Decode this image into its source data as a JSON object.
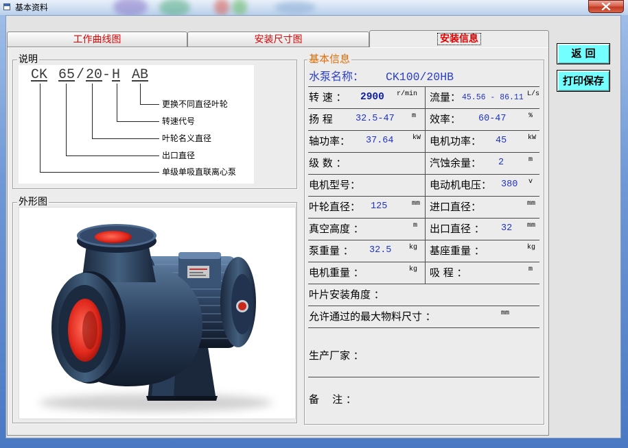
{
  "window": {
    "title": "基本资料"
  },
  "icons": {
    "window": "window-icon",
    "close": "close-icon"
  },
  "tabs": [
    {
      "label": "工作曲线图",
      "selected": false
    },
    {
      "label": "安装尺寸图",
      "selected": false
    },
    {
      "label": "安装信息",
      "selected": true
    }
  ],
  "buttons": {
    "back": "返 回",
    "print_save": "打印保存"
  },
  "description": {
    "title": "说明",
    "model_code_parts": [
      "CK",
      "65",
      "/",
      "20",
      "-",
      "H",
      "AB"
    ],
    "legend": [
      "更换不同直径叶轮",
      "转速代号",
      "叶轮名义直径",
      "出口直径",
      "单级单吸直联离心泵"
    ]
  },
  "appearance": {
    "title": "外形图"
  },
  "basic_info": {
    "title": "基本信息",
    "pump_name_label": "水泵名称：",
    "pump_name": "CK100/20HB",
    "rows": [
      {
        "left": {
          "label": "转 速 ：",
          "value": "2900",
          "unit": "r/min"
        },
        "right": {
          "label": "流量：",
          "value": "45.56 - 86.11",
          "unit": "L/s"
        }
      },
      {
        "left": {
          "label": "扬 程",
          "value": "32.5-47",
          "unit": "m"
        },
        "right": {
          "label": "效率：",
          "value": "60-47",
          "unit": "%"
        }
      },
      {
        "left": {
          "label": "轴功率：",
          "value": "37.64",
          "unit": "kW"
        },
        "right": {
          "label": "电机功率：",
          "value": "45",
          "unit": "kW"
        }
      },
      {
        "left": {
          "label": "级 数 ："
        },
        "right": {
          "label": "汽蚀余量：",
          "value": "2",
          "unit": "m"
        }
      },
      {
        "left": {
          "label": "电机型号："
        },
        "right": {
          "label": "电动机电压：",
          "value": "380",
          "unit": "v"
        }
      },
      {
        "left": {
          "label": "叶轮直径：",
          "value": "125",
          "unit": "mm"
        },
        "right": {
          "label": "进口直径：",
          "unit": "mm"
        }
      },
      {
        "left": {
          "label": "真空高度 ：",
          "unit": "m"
        },
        "right": {
          "label": "出口直径 ：",
          "value": "32",
          "unit": "mm"
        }
      },
      {
        "left": {
          "label": "泵重量 ：",
          "value": "32.5",
          "unit": "kg"
        },
        "right": {
          "label": "基座重量 ：",
          "unit": "kg"
        }
      },
      {
        "left": {
          "label": "电机重量 ：",
          "unit": "kg"
        },
        "right": {
          "label": "吸 程 ：",
          "unit": "m"
        }
      }
    ],
    "full_rows": [
      {
        "label": "叶片安装角度 ："
      },
      {
        "label": "允许通过的最大物料尺寸 ：",
        "unit": "mm"
      },
      {
        "label": "生产厂家 ："
      },
      {
        "label": "备    注 ："
      }
    ]
  },
  "colors": {
    "tab_text": "#e00000",
    "value_text": "#1f33c8",
    "group_title_accent": "#e36c09",
    "button_bg": "#73ffff",
    "title_blue": "#2b3fc7",
    "close_button": "#c23a22"
  }
}
